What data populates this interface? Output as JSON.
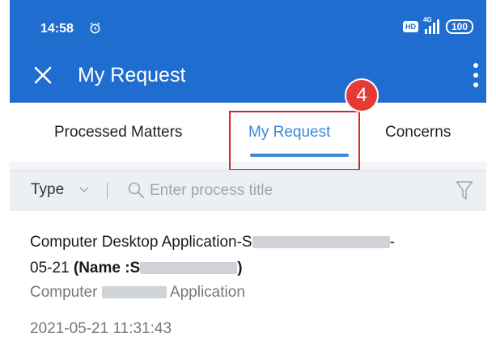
{
  "status_bar": {
    "time": "14:58",
    "hd": "HD",
    "network": "4G",
    "battery": "100"
  },
  "header": {
    "title": "My Request"
  },
  "tabs": [
    {
      "label": "Processed Matters",
      "active": false
    },
    {
      "label": "My Request",
      "active": true
    },
    {
      "label": "Concerns",
      "active": false
    }
  ],
  "annotation": {
    "step": "4"
  },
  "filter": {
    "type_label": "Type",
    "search_placeholder": "Enter process title"
  },
  "request_item": {
    "title_start": "Computer Desktop Application-S",
    "title_end": "-",
    "title_line2_date": "05-21 ",
    "name_label": "(Name :S",
    "name_close": ")",
    "category_start": "Computer ",
    "category_end": " Application",
    "created_at": "2021-05-21 11:31:43"
  },
  "colors": {
    "primary": "#1f6ecf",
    "active_tab": "#3d86d8",
    "highlight": "#d8232a",
    "badge": "#e43b36"
  }
}
